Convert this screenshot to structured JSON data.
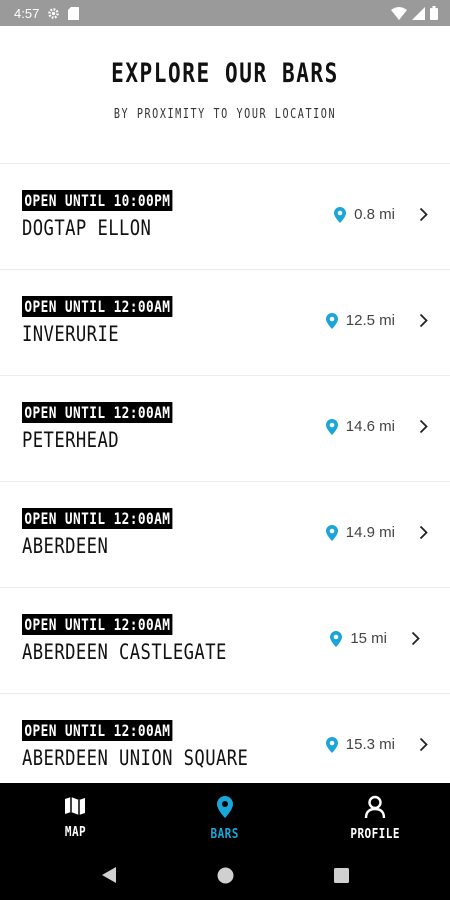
{
  "status_bar": {
    "time": "4:57",
    "icons": [
      "settings-gear-icon",
      "sd-card-icon",
      "wifi-icon",
      "signal-icon",
      "battery-icon"
    ]
  },
  "header": {
    "title": "EXPLORE OUR BARS",
    "subtitle": "BY PROXIMITY TO YOUR LOCATION"
  },
  "colors": {
    "accent": "#1aa6d8",
    "badge_bg": "#000000",
    "nav_bg": "#000000"
  },
  "bars": [
    {
      "hours": "OPEN UNTIL 10:00PM",
      "name": "DOGTAP ELLON",
      "distance": "0.8 mi"
    },
    {
      "hours": "OPEN UNTIL 12:00AM",
      "name": "INVERURIE",
      "distance": "12.5 mi"
    },
    {
      "hours": "OPEN UNTIL 12:00AM",
      "name": "PETERHEAD",
      "distance": "14.6 mi"
    },
    {
      "hours": "OPEN UNTIL 12:00AM",
      "name": "ABERDEEN",
      "distance": "14.9 mi"
    },
    {
      "hours": "OPEN UNTIL 12:00AM",
      "name": "ABERDEEN CASTLEGATE",
      "distance": "15 mi"
    },
    {
      "hours": "OPEN UNTIL 12:00AM",
      "name": "ABERDEEN UNION SQUARE",
      "distance": "15.3 mi"
    }
  ],
  "bottom_nav": {
    "items": [
      {
        "label": "MAP",
        "icon": "map-icon",
        "active": false
      },
      {
        "label": "BARS",
        "icon": "location-pin-icon",
        "active": true
      },
      {
        "label": "PROFILE",
        "icon": "person-icon",
        "active": false
      }
    ]
  },
  "system_nav": {
    "buttons": [
      "back-icon",
      "home-icon",
      "recents-icon"
    ]
  }
}
